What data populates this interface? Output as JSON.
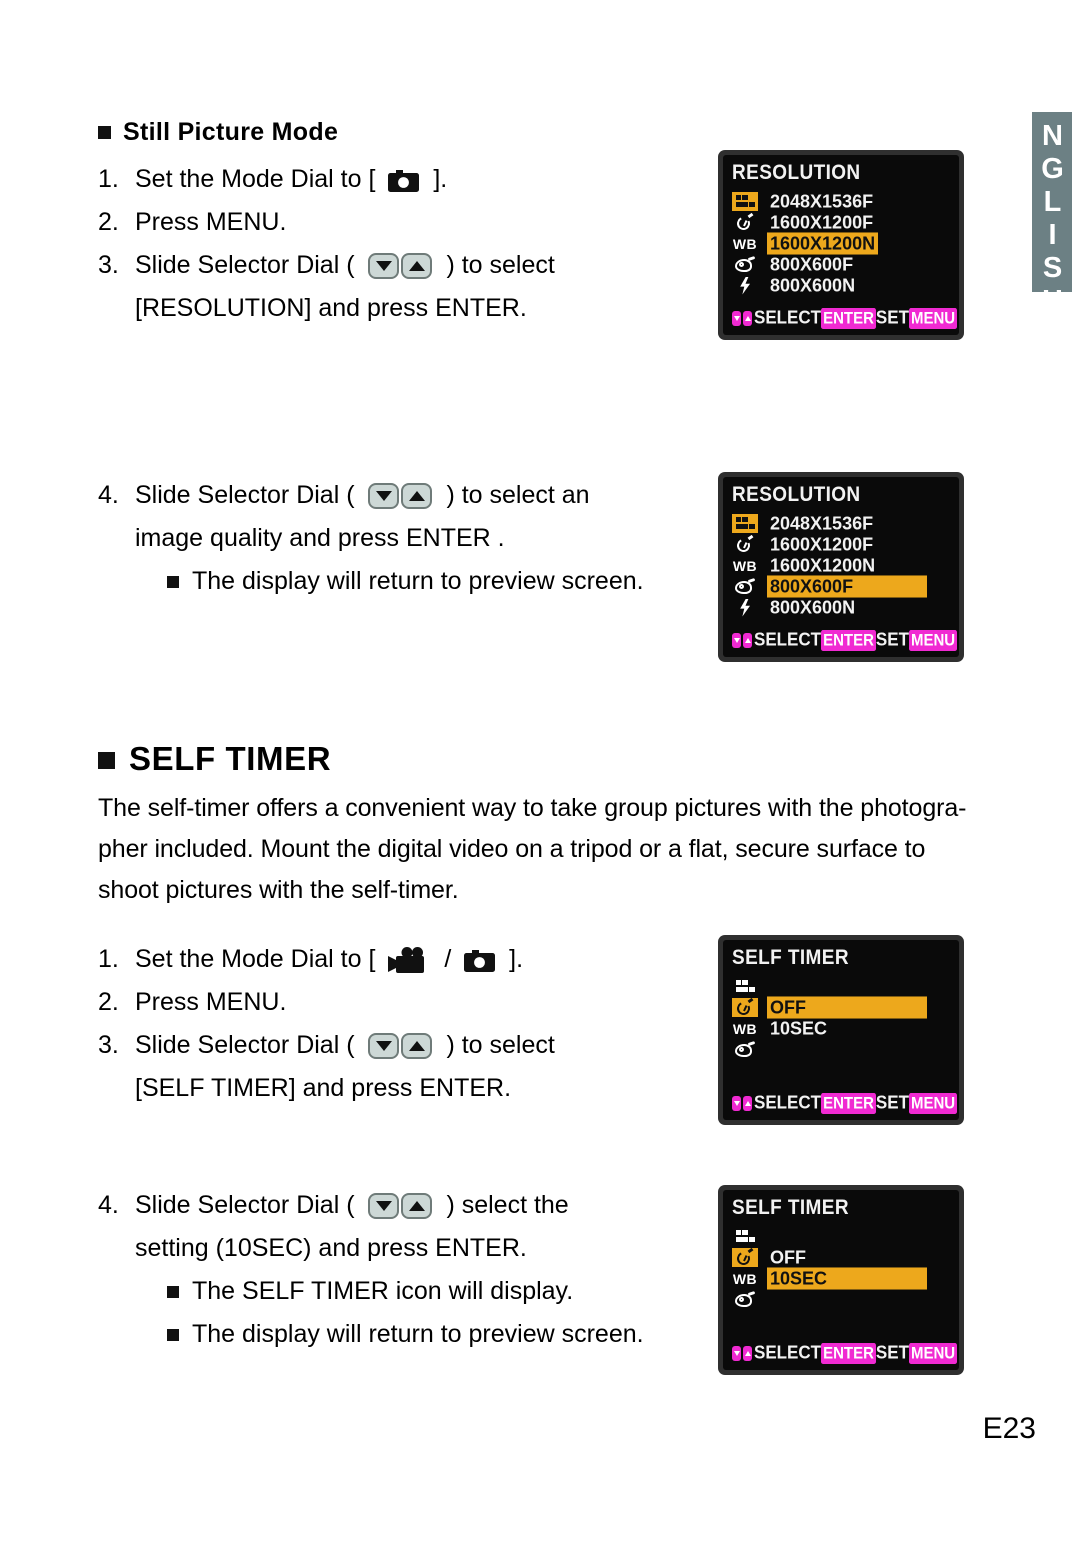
{
  "page": {
    "language_tab": "ENGLISH",
    "page_number": "E23"
  },
  "section_still": {
    "heading": "Still Picture Mode",
    "steps": [
      {
        "num": "1.",
        "text_before": "Set the Mode Dial to [",
        "icon": "still-camera-icon",
        "text_after": "]."
      },
      {
        "num": "2.",
        "text": "Press MENU."
      },
      {
        "num": "3.",
        "text_before": "Slide Selector Dial (",
        "icons": "selector-dial-down-up-icons",
        "text_after": ") to select",
        "continuation": "[RESOLUTION] and press ENTER."
      },
      {
        "num": "4.",
        "text_before": "Slide Selector Dial (",
        "icons": "selector-dial-down-up-icons",
        "text_after": ") to select an",
        "continuation": "image quality and press ENTER .",
        "bullets": [
          "The display will return to preview screen."
        ]
      }
    ]
  },
  "section_self_timer": {
    "heading": "SELF TIMER",
    "body": "The self-timer offers a convenient way to take group pictures with the photographer included. Mount the digital video on a tripod or a flat, secure surface to shoot pictures with the self-timer.",
    "body_lines": [
      "The self-timer offers a convenient way to take group pictures with the photogra-",
      "pher included. Mount the digital video on a tripod or a flat, secure surface to",
      "shoot pictures with the self-timer."
    ],
    "steps": [
      {
        "num": "1.",
        "text_before": "Set the Mode Dial to [",
        "icons": "video-camera-icon / still-camera-icon",
        "text_after": "]."
      },
      {
        "num": "2.",
        "text": "Press MENU."
      },
      {
        "num": "3.",
        "text_before": "Slide Selector Dial (",
        "icons": "selector-dial-down-up-icons",
        "text_after": ") to select",
        "continuation": "[SELF TIMER] and press ENTER."
      },
      {
        "num": "4.",
        "text_before": "Slide Selector Dial (",
        "icons": "selector-dial-down-up-icons",
        "text_after": ") select the",
        "continuation": "setting (10SEC) and press ENTER.",
        "bullets": [
          "The SELF TIMER icon will display.",
          "The display will return to preview screen."
        ]
      }
    ]
  },
  "colors": {
    "lcd_highlight": "#eda81c",
    "lcd_key_magenta": "#f02ad2",
    "lcd_background": "#0a0a0a",
    "lcd_frame": "#2f2f2f",
    "lang_tab": "#6c8084"
  },
  "lcd_bar": {
    "select_label": "SELECT",
    "enter_key": "ENTER",
    "set_label": "SET",
    "menu_key": "MENU"
  },
  "lcd_screens": [
    {
      "id": "resolution-1",
      "title": "RESOLUTION",
      "menu_icons": [
        "resolution-grid-icon",
        "self-timer-clock-icon",
        "white-balance-icon",
        "effect-palette-icon",
        "flash-icon"
      ],
      "selected_menu_icon_index": 0,
      "options": [
        "2048X1536F",
        "1600X1200F",
        "1600X1200N",
        "800X600F",
        "800X600N"
      ],
      "highlighted_option": "1600X1200N",
      "highlighted_index": 2
    },
    {
      "id": "resolution-2",
      "title": "RESOLUTION",
      "menu_icons": [
        "resolution-grid-icon",
        "self-timer-clock-icon",
        "white-balance-icon",
        "effect-palette-icon",
        "flash-icon"
      ],
      "selected_menu_icon_index": 0,
      "options": [
        "2048X1536F",
        "1600X1200F",
        "1600X1200N",
        "800X600F",
        "800X600N"
      ],
      "highlighted_option": "800X600F",
      "highlighted_index": 3
    },
    {
      "id": "self-timer-1",
      "title": "SELF TIMER",
      "menu_icons": [
        "resolution-grid-icon",
        "self-timer-clock-icon",
        "white-balance-icon",
        "effect-palette-icon"
      ],
      "selected_menu_icon_index": 1,
      "options": [
        "OFF",
        "10SEC"
      ],
      "highlighted_option": "OFF",
      "highlighted_index": 0
    },
    {
      "id": "self-timer-2",
      "title": "SELF TIMER",
      "menu_icons": [
        "resolution-grid-icon",
        "self-timer-clock-icon",
        "white-balance-icon",
        "effect-palette-icon"
      ],
      "selected_menu_icon_index": 1,
      "options": [
        "OFF",
        "10SEC"
      ],
      "highlighted_option": "10SEC",
      "highlighted_index": 1
    }
  ],
  "wb_label": "WB"
}
